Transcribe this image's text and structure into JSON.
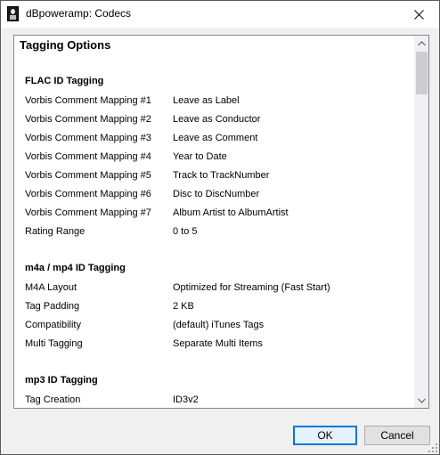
{
  "window": {
    "title": "dBpoweramp: Codecs",
    "icon": "dbpoweramp-app-icon",
    "close_icon": "close-icon"
  },
  "panel": {
    "title": "Tagging Options",
    "sections": [
      {
        "title": "FLAC ID Tagging",
        "rows": [
          {
            "label": "Vorbis Comment Mapping #1",
            "value": "Leave as Label"
          },
          {
            "label": "Vorbis Comment Mapping #2",
            "value": "Leave as Conductor"
          },
          {
            "label": "Vorbis Comment Mapping #3",
            "value": "Leave as Comment"
          },
          {
            "label": "Vorbis Comment Mapping #4",
            "value": "Year to Date"
          },
          {
            "label": "Vorbis Comment Mapping #5",
            "value": "Track to TrackNumber"
          },
          {
            "label": "Vorbis Comment Mapping #6",
            "value": "Disc to DiscNumber"
          },
          {
            "label": "Vorbis Comment Mapping #7",
            "value": "Album Artist to AlbumArtist"
          },
          {
            "label": "Rating Range",
            "value": "0 to 5"
          }
        ]
      },
      {
        "title": "m4a / mp4 ID Tagging",
        "rows": [
          {
            "label": "M4A Layout",
            "value": "Optimized for Streaming (Fast Start)"
          },
          {
            "label": "Tag Padding",
            "value": "2 KB"
          },
          {
            "label": "Compatibility",
            "value": "(default) iTunes Tags"
          },
          {
            "label": "Multi Tagging",
            "value": "Separate Multi Items"
          }
        ]
      },
      {
        "title": "mp3 ID Tagging",
        "rows": [
          {
            "label": "Tag Creation",
            "value": "ID3v2"
          }
        ]
      }
    ]
  },
  "buttons": {
    "ok": "OK",
    "cancel": "Cancel"
  }
}
